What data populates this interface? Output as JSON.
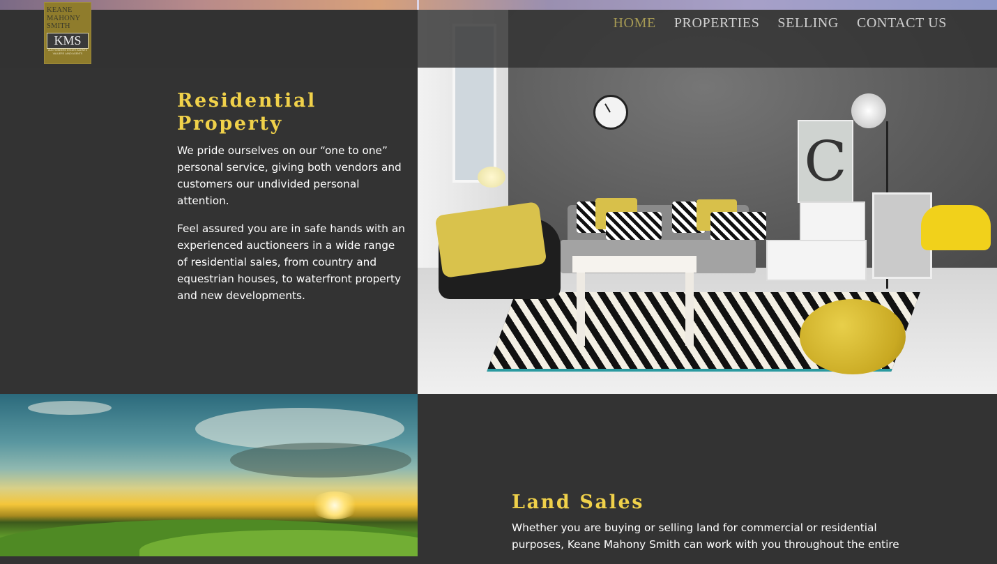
{
  "brand": {
    "logo_lines": [
      "KEANE",
      "MAHONY",
      "SMITH"
    ],
    "logo_mark": "KMS",
    "logo_tagline_1": "AUCTIONEERS  ESTATE AGENTS",
    "logo_tagline_2": "VALUERS  LAND AGENTS"
  },
  "nav": {
    "items": [
      {
        "label": "HOME",
        "active": true
      },
      {
        "label": "PROPERTIES",
        "active": false
      },
      {
        "label": "SELLING",
        "active": false
      },
      {
        "label": "CONTACT US",
        "active": false
      }
    ]
  },
  "residential": {
    "title_line_1": "Residential",
    "title_line_2": "Property",
    "paragraph_1": "We pride ourselves on our “one to one” personal service, giving both vendors and customers our undivided personal attention.",
    "paragraph_2": "Feel assured you are in safe hands with an experienced auctioneers in a wide range of residential sales, from country and equestrian houses, to waterfront property and new developments."
  },
  "land": {
    "title": "Land Sales",
    "paragraph_1": "Whether you are buying or selling land for commercial or residential purposes, Keane Mahony Smith can work with you throughout the entire"
  },
  "colors": {
    "background": "#333333",
    "accent_yellow": "#f0d14a",
    "nav_active": "#a69a54",
    "nav_text": "#d0d0d0",
    "logo_bg": "#8f7c2c"
  },
  "icons": {
    "living_room_photo": "living-room-photo",
    "landscape_photo": "landscape-photo"
  }
}
